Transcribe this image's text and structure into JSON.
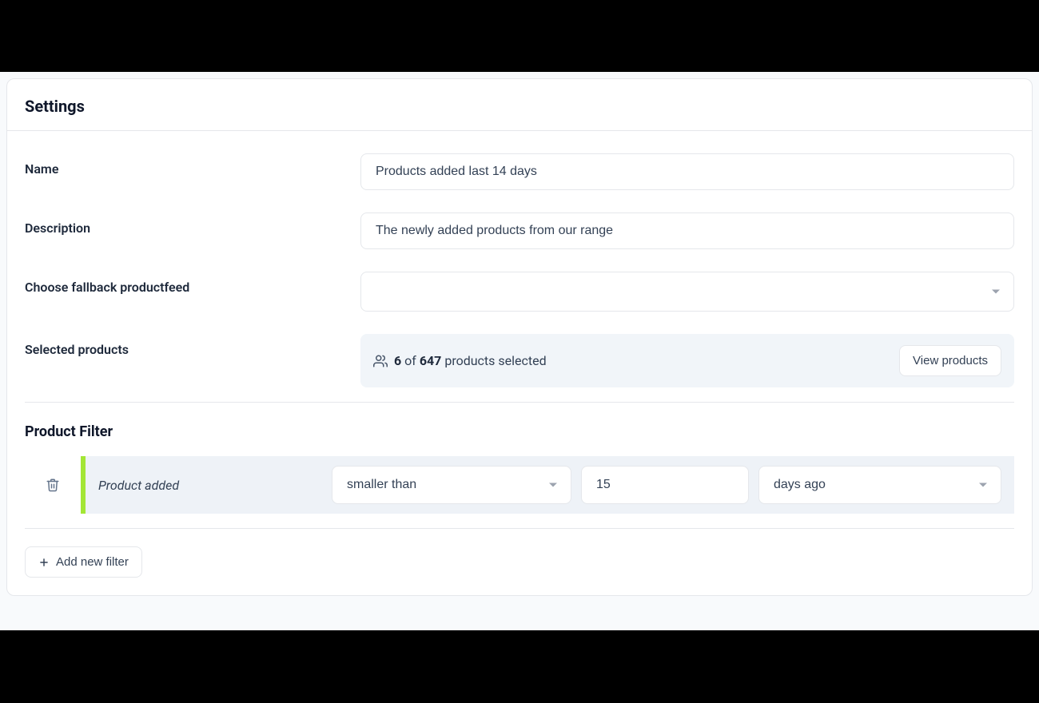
{
  "header": {
    "title": "Settings"
  },
  "form": {
    "name": {
      "label": "Name",
      "value": "Products added last 14 days"
    },
    "description": {
      "label": "Description",
      "value": "The newly added products from our range"
    },
    "fallback": {
      "label": "Choose fallback productfeed",
      "value": ""
    },
    "selected": {
      "label": "Selected products",
      "count": "6",
      "of_text": " of ",
      "total": "647",
      "suffix": " products selected",
      "view_btn": "View products"
    }
  },
  "filter_section": {
    "title": "Product Filter",
    "rows": [
      {
        "field": "Product added",
        "operator": "smaller than",
        "value": "15",
        "unit": "days ago"
      }
    ],
    "add_label": "Add new filter"
  }
}
